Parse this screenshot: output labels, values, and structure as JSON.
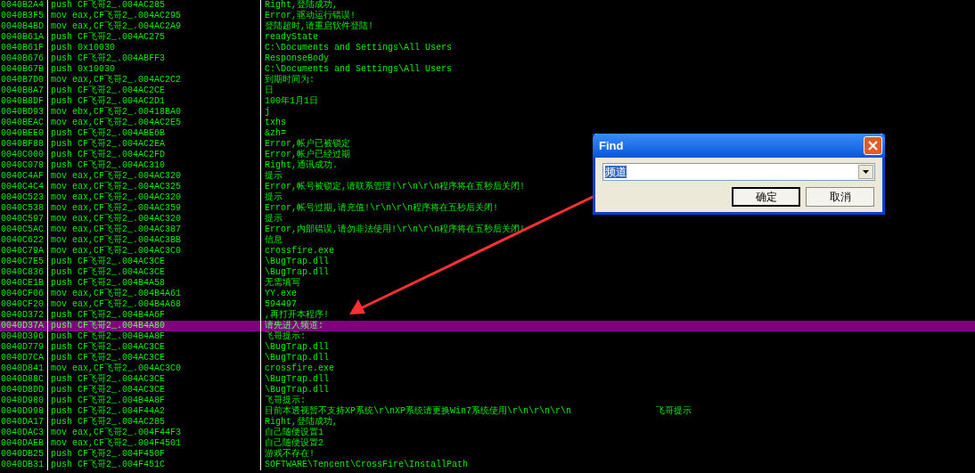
{
  "listing": {
    "rows": [
      {
        "address": "0040B2A4",
        "instruction": "push CF飞哥2_.004AC285",
        "string": "Right,登陆成功,",
        "selected": false
      },
      {
        "address": "0040B3F5",
        "instruction": "mov eax,CF飞哥2_.004AC295",
        "string": "Error,驱动运行错误!",
        "selected": false
      },
      {
        "address": "0040B4BD",
        "instruction": "mov eax,CF飞哥2_.004AC2A9",
        "string": "登陆超时,请重启软件登陆!",
        "selected": false
      },
      {
        "address": "0040B61A",
        "instruction": "push CF飞哥2_.004AC275",
        "string": "readyState",
        "selected": false
      },
      {
        "address": "0040B61F",
        "instruction": "push 0x10030",
        "string": "C:\\Documents and Settings\\All Users",
        "selected": false
      },
      {
        "address": "0040B676",
        "instruction": "push CF飞哥2_.004ABFF3",
        "string": "ResponseBody",
        "selected": false
      },
      {
        "address": "0040B67B",
        "instruction": "push 0x10030",
        "string": "C:\\Documents and Settings\\All Users",
        "selected": false
      },
      {
        "address": "0040B7D0",
        "instruction": "mov eax,CF飞哥2_.004AC2C2",
        "string": "到期时间为:",
        "selected": false
      },
      {
        "address": "0040B8A7",
        "instruction": "push CF飞哥2_.004AC2CE",
        "string": "日",
        "selected": false
      },
      {
        "address": "0040B8DF",
        "instruction": "push CF飞哥2_.004AC2D1",
        "string": "100年1月1日",
        "selected": false
      },
      {
        "address": "0040BD93",
        "instruction": "mov ebx,CF飞哥2_.00418BA0",
        "string": "j",
        "selected": false
      },
      {
        "address": "0040BEAC",
        "instruction": "mov eax,CF飞哥2_.004AC2E5",
        "string": "txhs",
        "selected": false
      },
      {
        "address": "0040BEE0",
        "instruction": "push CF飞哥2_.004ABE6B",
        "string": "&zh=",
        "selected": false
      },
      {
        "address": "0040BF88",
        "instruction": "push CF飞哥2_.004AC2EA",
        "string": "Error,帐户已被锁定",
        "selected": false
      },
      {
        "address": "0040C000",
        "instruction": "push CF飞哥2_.004AC2FD",
        "string": "Error,帐户已经过期",
        "selected": false
      },
      {
        "address": "0040C078",
        "instruction": "push CF飞哥2_.004AC310",
        "string": "Right,通讯成功.",
        "selected": false
      },
      {
        "address": "0040C4AF",
        "instruction": "mov eax,CF飞哥2_.004AC320",
        "string": "提示",
        "selected": false
      },
      {
        "address": "0040C4C4",
        "instruction": "mov eax,CF飞哥2_.004AC325",
        "string": "Error,帐号被锁定,请联系管理!\\r\\n\\r\\n程序将在五秒后关闭!",
        "selected": false
      },
      {
        "address": "0040C523",
        "instruction": "mov eax,CF飞哥2_.004AC320",
        "string": "提示",
        "selected": false
      },
      {
        "address": "0040C538",
        "instruction": "mov eax,CF飞哥2_.004AC359",
        "string": "Error,帐号过期,请充值!\\r\\n\\r\\n程序将在五秒后关闭!",
        "selected": false
      },
      {
        "address": "0040C597",
        "instruction": "mov eax,CF飞哥2_.004AC320",
        "string": "提示",
        "selected": false
      },
      {
        "address": "0040C5AC",
        "instruction": "mov eax,CF飞哥2_.004AC387",
        "string": "Error,内部错误,请勿非法使用!\\r\\n\\r\\n程序将在五秒后关闭!",
        "selected": false
      },
      {
        "address": "0040C622",
        "instruction": "mov eax,CF飞哥2_.004AC3BB",
        "string": "信息",
        "selected": false
      },
      {
        "address": "0040C79A",
        "instruction": "mov eax,CF飞哥2_.004AC3C0",
        "string": "crossfire.exe",
        "selected": false
      },
      {
        "address": "0040C7E5",
        "instruction": "push CF飞哥2_.004AC3CE",
        "string": "\\BugTrap.dll",
        "selected": false
      },
      {
        "address": "0040C836",
        "instruction": "push CF飞哥2_.004AC3CE",
        "string": "\\BugTrap.dll",
        "selected": false
      },
      {
        "address": "0040CE1B",
        "instruction": "push CF飞哥2_.004B4A58",
        "string": "无需填写",
        "selected": false
      },
      {
        "address": "0040CF06",
        "instruction": "mov eax,CF飞哥2_.004B4A61",
        "string": "YY.exe",
        "selected": false
      },
      {
        "address": "0040CF20",
        "instruction": "mov eax,CF飞哥2_.004B4A68",
        "string": "594497",
        "selected": false
      },
      {
        "address": "0040D372",
        "instruction": "push CF飞哥2_.004B4A6F",
        "string": ",再打开本程序!",
        "selected": false
      },
      {
        "address": "0040D37A",
        "instruction": "push CF飞哥2_.004B4A80",
        "string": "请先进入频道:",
        "selected": true
      },
      {
        "address": "0040D396",
        "instruction": "push CF飞哥2_.004B4A8F",
        "string": "飞哥提示:",
        "selected": false
      },
      {
        "address": "0040D779",
        "instruction": "push CF飞哥2_.004AC3CE",
        "string": "\\BugTrap.dll",
        "selected": false
      },
      {
        "address": "0040D7CA",
        "instruction": "push CF飞哥2_.004AC3CE",
        "string": "\\BugTrap.dll",
        "selected": false
      },
      {
        "address": "0040D841",
        "instruction": "mov eax,CF飞哥2_.004AC3C0",
        "string": "crossfire.exe",
        "selected": false
      },
      {
        "address": "0040D88C",
        "instruction": "push CF飞哥2_.004AC3CE",
        "string": "\\BugTrap.dll",
        "selected": false
      },
      {
        "address": "0040D8DD",
        "instruction": "push CF飞哥2_.004AC3CE",
        "string": "\\BugTrap.dll",
        "selected": false
      },
      {
        "address": "0040D980",
        "instruction": "push CF飞哥2_.004B4A8F",
        "string": "飞哥提示:",
        "selected": false
      },
      {
        "address": "0040D998",
        "instruction": "push CF飞哥2_.004F44A2",
        "string": "目前本透视暂不支持XP系统\\r\\nXP系统请更换Win7系统使用\\r\\n\\r\\n\\r\\n",
        "tail": "飞哥提示",
        "selected": false
      },
      {
        "address": "0040DA17",
        "instruction": "push CF飞哥2_.004AC285",
        "string": "Right,登陆成功,",
        "selected": false
      },
      {
        "address": "0040DAC3",
        "instruction": "mov eax,CF飞哥2_.004F44F3",
        "string": "自己随便设置1",
        "selected": false
      },
      {
        "address": "0040DAEB",
        "instruction": "mov eax,CF飞哥2_.004F4501",
        "string": "自己随便设置2",
        "selected": false
      },
      {
        "address": "0040DB25",
        "instruction": "push CF飞哥2_.004F450F",
        "string": "游戏不存在!",
        "selected": false
      },
      {
        "address": "0040DB31",
        "instruction": "push CF飞哥2_.004F451C",
        "string": "SOFTWARE\\Tencent\\CrossFire\\InstallPath",
        "selected": false
      }
    ]
  },
  "find_dialog": {
    "title": "Find",
    "value": "频道",
    "buttons": [
      {
        "label": "确定",
        "default": true
      },
      {
        "label": "取消",
        "default": false
      }
    ]
  }
}
